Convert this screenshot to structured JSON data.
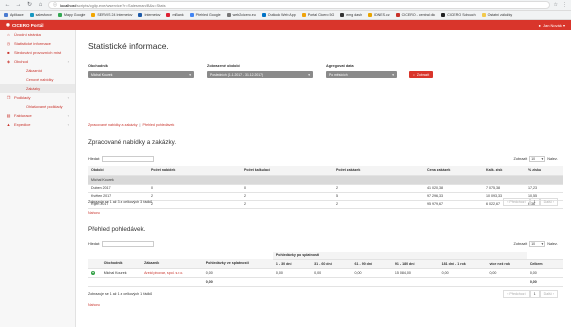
{
  "browser": {
    "nav_back": "←",
    "nav_forward": "→",
    "nav_reload": "↻",
    "nav_home": "⌂",
    "url_host": "localhost",
    "url_path": "/scripts/cgiip.exe/wservice?r=Salesman/B&s=Stats",
    "right_icons": [
      "☆",
      "⋮"
    ],
    "bookmarks": [
      {
        "label": "Aplikace",
        "color": "#4a7bd0"
      },
      {
        "label": "salesforce",
        "color": "#1798c1"
      },
      {
        "label": "Mapy Google",
        "color": "#34a853"
      },
      {
        "label": "SERVIS 24 Internetov",
        "color": "#f2a600"
      },
      {
        "label": "Internetov",
        "color": "#1e5aa8"
      },
      {
        "label": "mBank",
        "color": "#d23"
      },
      {
        "label": "Přehled Google",
        "color": "#4285f4"
      },
      {
        "label": "web2cicero.eu",
        "color": "#777"
      },
      {
        "label": "Outlook Web App",
        "color": "#0072c6"
      },
      {
        "label": "Portal Cicero 5G",
        "color": "#f0a30a"
      },
      {
        "label": "emg dash",
        "color": "#333"
      },
      {
        "label": "IDNES.cz",
        "color": "#e8a400"
      },
      {
        "label": "CICERO - central dic",
        "color": "#c8322a"
      },
      {
        "label": "CICERO Sdrouch",
        "color": "#222"
      },
      {
        "label": "Ostatní záložky",
        "color": "#f2c94c"
      }
    ]
  },
  "header": {
    "brand": "CICERO Portál",
    "user": "Jan Novák ▾"
  },
  "sidebar": {
    "items": [
      {
        "label": "Úvodní stránka",
        "icon": "⌂"
      },
      {
        "label": "Statistické informace",
        "icon": "◷"
      },
      {
        "label": "Sledování provozních míst",
        "icon": "■"
      },
      {
        "label": "Obchod",
        "icon": "◈",
        "chev": "›"
      }
    ],
    "sub_items": [
      "Zákazníci",
      "Cenové nabídky",
      "Zakázky"
    ],
    "items2": [
      {
        "label": "Podklady",
        "icon": "❐",
        "chev": "‹"
      },
      {
        "label": "Ohlašované podklady",
        "icon": ""
      },
      {
        "label": "Fakturace",
        "icon": "▤",
        "chev": "‹"
      },
      {
        "label": "Expedice",
        "icon": "▲",
        "chev": "‹"
      }
    ]
  },
  "main": {
    "title": "Statistické informace.",
    "filters": {
      "obchodnik_label": "Obchodník",
      "obchodnik_value": "Michal Kourek",
      "obdobi_label": "Zobrazené období",
      "obdobi_value": "Posledních (1.1.2017 - 31.12.2017)",
      "agregace_label": "Agregovat data",
      "agregace_value": "Po měsících",
      "zobrazit_button": "Zobrazit",
      "caret": "▾"
    },
    "export_links": [
      "Zpracované nabídky a zakázky",
      "Přehled pohledávek"
    ],
    "export_sep": "|",
    "section1_title": "Zpracované nabídky a zakázky.",
    "search_label": "Hledat:",
    "zobrazit_label": "Zobrazit",
    "zobrazit_value": "10",
    "zobrazit_suffix": "Nalez.",
    "table1": {
      "headers": [
        "Období",
        "Počet nabídek",
        "Počet kalkulací",
        "Počet zakázek",
        "Cena zakázek",
        "Kalk. zisk",
        "% zisku"
      ],
      "group": "Michal Kourek",
      "rows": [
        [
          "Duben 2017",
          "0",
          "0",
          "2",
          "41 020,38",
          "7 075,38",
          "17,23"
        ],
        [
          "Květen 2017",
          "2",
          "2",
          "5",
          "97 296,33",
          "10 093,33",
          "10,55"
        ],
        [
          "Říjen 2017",
          "2",
          "2",
          "2",
          "95 979,67",
          "6 022,67",
          "6,36"
        ]
      ],
      "info": "Zobrazuje se 1 až 3 z celkových 3 řádků",
      "pager_prev": "‹ Předchozí",
      "pager_page": "1",
      "pager_next": "Další ›"
    },
    "nahoru": "Nahoru",
    "section2_title": "Přehled pohledávek.",
    "table2": {
      "super_header": "Pohledávky po splatnosti",
      "headers": [
        "",
        "Obchodník",
        "Zákazník",
        "Pohledávky ve splatnosti",
        "1 - 30 dní",
        "31 - 60 dní",
        "61 - 90 dní",
        "91 - 180 dní",
        "181 dní - 1 rok",
        "více než rok",
        "Celkem"
      ],
      "row": [
        "",
        "Michal Kourek",
        "Areál pivovar, spol. s.r.o.",
        "0,00",
        "0,00",
        "0,00",
        "0,00",
        "15 084,00",
        "0,00",
        "0,00",
        "0,00"
      ],
      "sum": [
        "",
        "",
        "",
        "0,00",
        "",
        "",
        "",
        "",
        "",
        "",
        "0,00"
      ],
      "info": "Zobrazuje se 1 až 1 z celkových 1 řádků"
    }
  }
}
